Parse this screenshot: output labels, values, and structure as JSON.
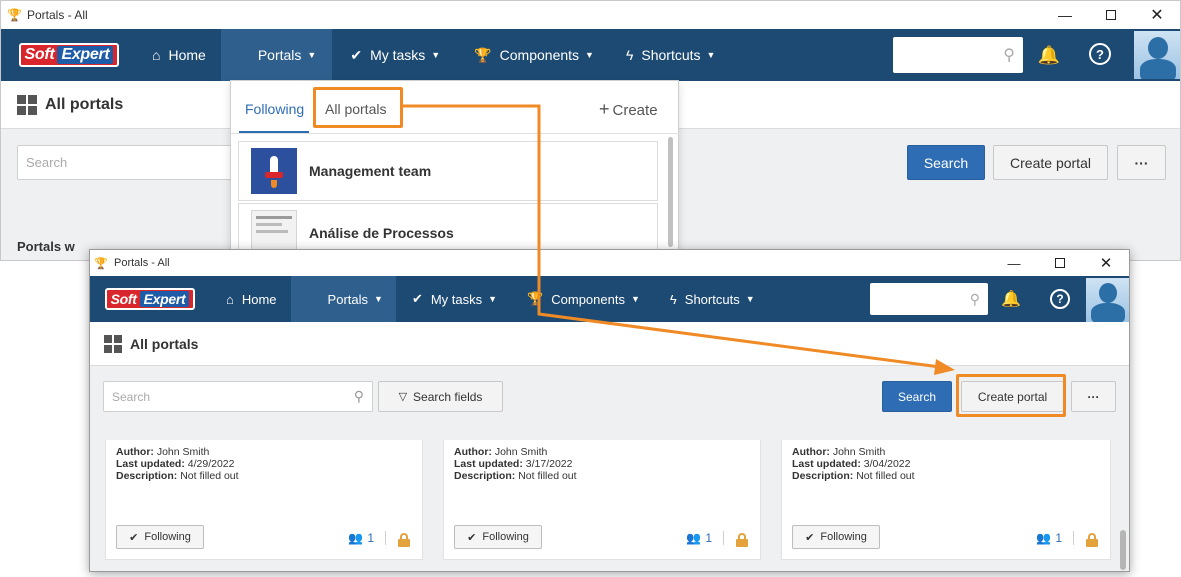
{
  "back_window": {
    "title": "Portals - All",
    "nav": {
      "logo_soft": "Soft",
      "logo_expert": "Expert",
      "home": "Home",
      "portals": "Portals",
      "my_tasks": "My tasks",
      "components": "Components",
      "shortcuts": "Shortcuts"
    },
    "page_title": "All portals",
    "search_placeholder": "Search",
    "search_button": "Search",
    "create_portal_button": "Create portal",
    "more_button": "···",
    "section_label": "Portals w",
    "dropdown": {
      "tab_following": "Following",
      "tab_all_portals": "All portals",
      "create": "Create",
      "items": [
        {
          "name": "Management team"
        },
        {
          "name": "Análise de Processos"
        }
      ]
    }
  },
  "front_window": {
    "title": "Portals - All",
    "nav": {
      "logo_soft": "Soft",
      "logo_expert": "Expert",
      "home": "Home",
      "portals": "Portals",
      "my_tasks": "My tasks",
      "components": "Components",
      "shortcuts": "Shortcuts"
    },
    "page_title": "All portals",
    "search_placeholder": "Search",
    "search_fields_button": "Search fields",
    "search_button": "Search",
    "create_portal_button": "Create portal",
    "more_button": "···",
    "cards": [
      {
        "author_label": "Author:",
        "author": "John Smith",
        "updated_label": "Last updated:",
        "updated": "4/29/2022",
        "description_label": "Description:",
        "description": "Not filled out",
        "follow_label": "Following",
        "members": "1"
      },
      {
        "author_label": "Author:",
        "author": "John Smith",
        "updated_label": "Last updated:",
        "updated": "3/17/2022",
        "description_label": "Description:",
        "description": "Not filled out",
        "follow_label": "Following",
        "members": "1"
      },
      {
        "author_label": "Author:",
        "author": "John Smith",
        "updated_label": "Last updated:",
        "updated": "3/04/2022",
        "description_label": "Description:",
        "description": "Not filled out",
        "follow_label": "Following",
        "members": "1"
      }
    ]
  },
  "colors": {
    "navbar": "#1d4a72",
    "primary": "#2e6db4",
    "highlight": "#ef8a24"
  },
  "icons": [
    "trophy-icon",
    "home-icon",
    "grid-icon",
    "check-icon",
    "trophy-icon",
    "bolt-icon",
    "search-icon",
    "bell-icon",
    "help-icon",
    "users-icon",
    "lock-icon",
    "filter-icon",
    "plus-icon"
  ]
}
